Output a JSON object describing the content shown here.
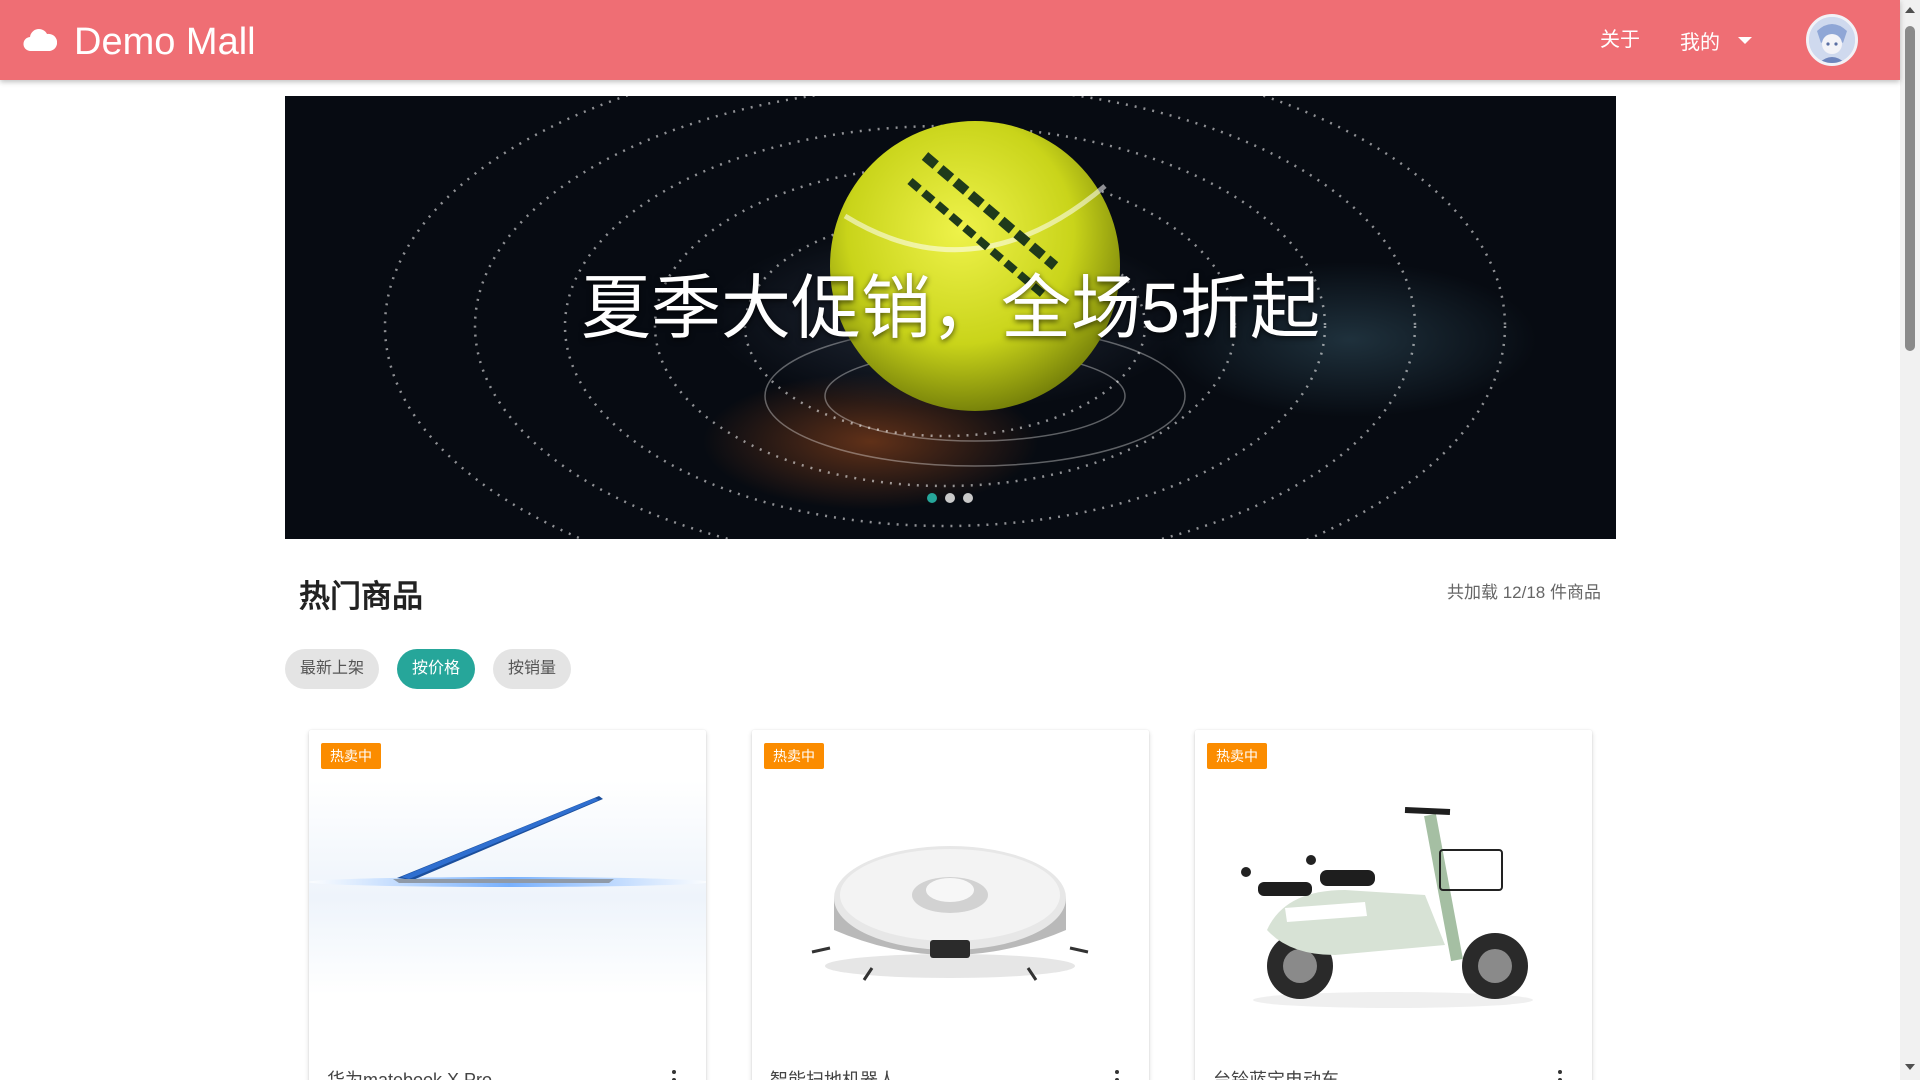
{
  "app": {
    "title": "Demo Mall",
    "brand_icon": "cloud-icon",
    "accent_color": "#ef6e74"
  },
  "nav": {
    "about_label": "关于",
    "mine_label": "我的",
    "dropdown_icon": "caret-down-icon",
    "avatar_icon": "user-avatar"
  },
  "banner": {
    "headline": "夏季大促销，全场5折起",
    "slide_count": 3,
    "active_slide": 1,
    "indicator_color": "#26a69a"
  },
  "section": {
    "title": "热门商品",
    "load_status": "共加载 12/18 件商品"
  },
  "sort": {
    "options": [
      "最新上架",
      "按价格",
      "按销量"
    ],
    "selected": "按价格",
    "selected_color": "#26a69a"
  },
  "products": [
    {
      "badge": "热卖中",
      "name": "华为matebook X Pro",
      "image": "laptop"
    },
    {
      "badge": "热卖中",
      "name": "智能扫地机器人",
      "image": "robot-vacuum"
    },
    {
      "badge": "热卖中",
      "name": "台铃蓝宝电动车",
      "image": "electric-scooter"
    }
  ],
  "badge_color": "#fb8c00"
}
